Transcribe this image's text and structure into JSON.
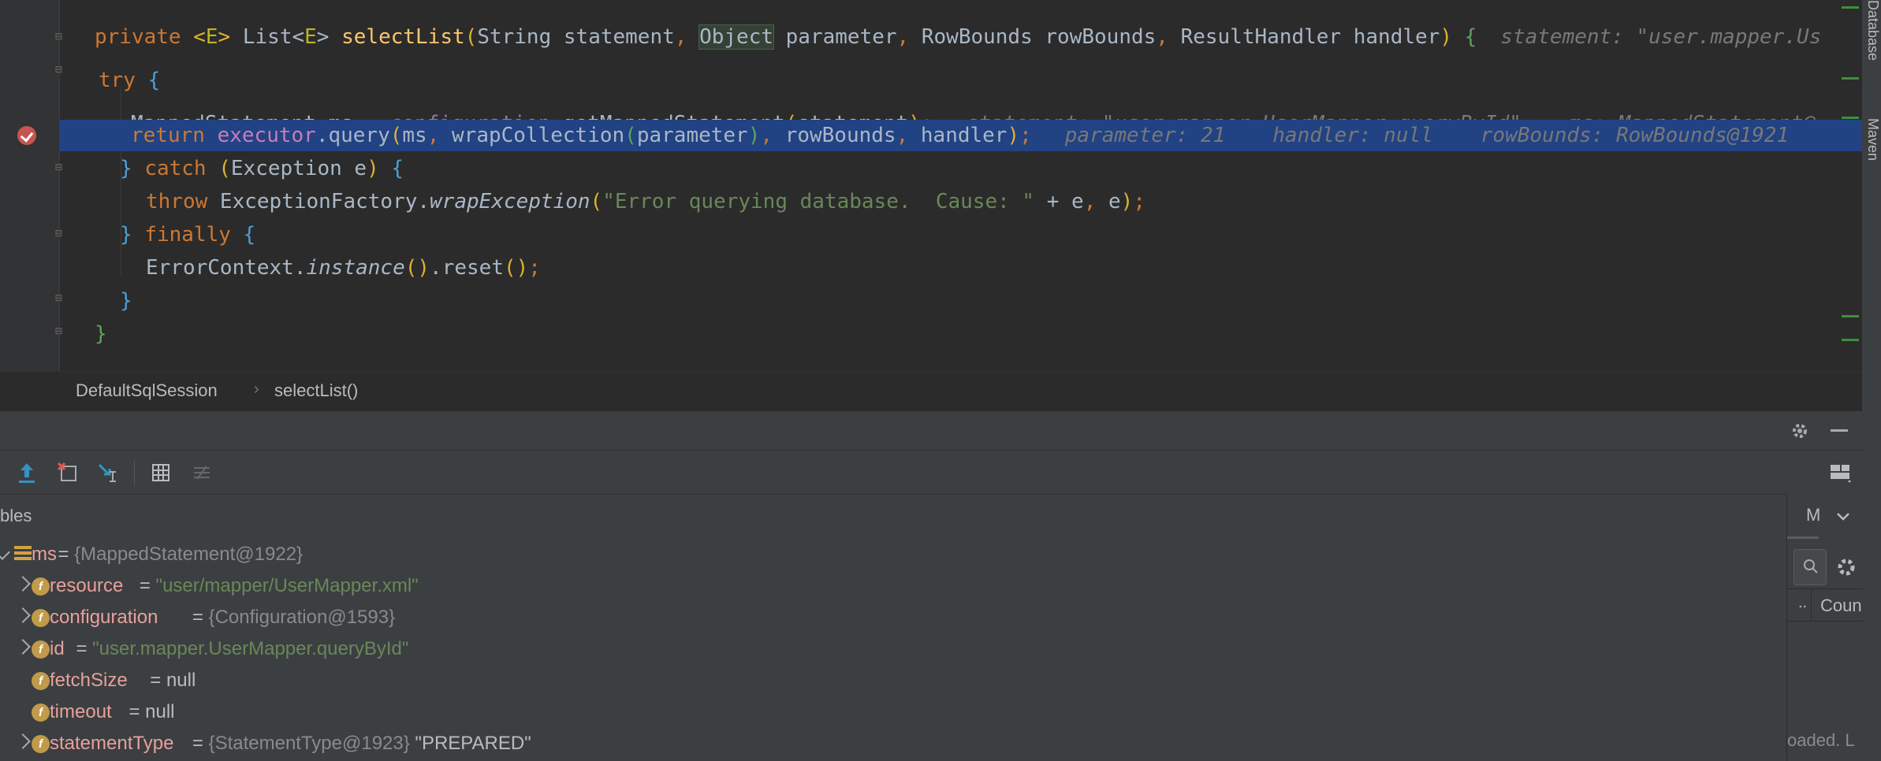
{
  "colors": {
    "editor_bg": "#2b2b2b",
    "panel_bg": "#3c3f41",
    "highlight_line": "#214283",
    "keyword": "#cc7832",
    "function": "#ffc66d",
    "field": "#9876aa",
    "string": "#6a8759",
    "var_name": "#e8a09c",
    "breakpoint": "#c75450"
  },
  "editor": {
    "lines": {
      "l1": {
        "private": "private ",
        "gen_open": "<",
        "gen_e": "E",
        "gen_close": "> ",
        "list": "List",
        "lt": "<",
        "e2": "E",
        "gt": "> ",
        "method": "selectList",
        "paren": "(",
        "p1": "String statement",
        "comma1": ", ",
        "object": "Object",
        "p2": " parameter",
        "comma2": ", ",
        "p3": "RowBounds rowBounds",
        "comma3": ", ",
        "p4": "ResultHandler handler",
        "close": ") ",
        "brace": "{",
        "hint": "statement: \"user.mapper.Us"
      },
      "l2": {
        "kw": "try ",
        "brace": "{"
      },
      "l3": {
        "type": "MappedStatement ms = ",
        "field": "configuration",
        "call": ".getMappedStatement",
        "paren_open": "(",
        "arg": "statement",
        "paren_close": ")",
        "semi": ";",
        "hint1": "statement: \"user.mapper.UserMapper.queryById\"",
        "hint2": "ms: MappedStatement@"
      },
      "l4": {
        "kw": "return ",
        "field": "executor",
        "call": ".query",
        "paren_open": "(",
        "a1": "ms",
        "c1": ", ",
        "a2": "wrapCollection",
        "p_open": "(",
        "a2arg": "parameter",
        "p_close": ")",
        "c2": ", ",
        "a3": "rowBounds",
        "c3": ", ",
        "a4": "handler",
        "paren_close": ")",
        "semi": ";",
        "hint1": "parameter: 21",
        "hint2": "handler: null",
        "hint3": "rowBounds: RowBounds@1921"
      },
      "l5": {
        "brace": "} ",
        "kw": "catch ",
        "paren_open": "(",
        "arg": "Exception e",
        "paren_close": ") ",
        "brace2": "{"
      },
      "l6": {
        "kw": "throw ",
        "cls": "ExceptionFactory.",
        "method": "wrapException",
        "paren_open": "(",
        "str": "\"Error querying database.  Cause: \"",
        "rest": " + e",
        "comma": ", ",
        "e": "e",
        "paren_close": ")",
        "semi": ";"
      },
      "l7": {
        "brace": "} ",
        "kw": "finally ",
        "brace2": "{"
      },
      "l8": {
        "cls": "ErrorContext.",
        "method": "instance",
        "p1": "()",
        "call": ".reset",
        "p2": "()",
        "semi": ";"
      },
      "l9": {
        "brace": "}"
      },
      "l10": {
        "brace": "}"
      }
    }
  },
  "right_strip": {
    "database_tab": "Database",
    "maven_tab": "Maven"
  },
  "breadcrumb": {
    "item1": "DefaultSqlSession",
    "item2": "selectList()"
  },
  "debug": {
    "vars_title": "bles",
    "watches_tab": "M",
    "watches_col": "Coun",
    "watches_dots": "..",
    "loaded_text": "oaded. L",
    "variables": [
      {
        "name": "ms",
        "eq": " = ",
        "value": "{MappedStatement@1922}",
        "expanded": true,
        "kind": "object"
      },
      {
        "name": "resource",
        "eq": " = ",
        "value": "\"user/mapper/UserMapper.xml\"",
        "kind": "field",
        "is_string": true,
        "has_arrow": true
      },
      {
        "name": "configuration",
        "eq": " = ",
        "value": "{Configuration@1593}",
        "kind": "field",
        "has_arrow": true
      },
      {
        "name": "id",
        "eq": " = ",
        "value": "\"user.mapper.UserMapper.queryById\"",
        "kind": "field",
        "is_string": true,
        "has_arrow": true
      },
      {
        "name": "fetchSize",
        "eq": " = ",
        "value": "null",
        "kind": "field",
        "has_arrow": false
      },
      {
        "name": "timeout",
        "eq": " = ",
        "value": "null",
        "kind": "field",
        "has_arrow": false
      },
      {
        "name": "statementType",
        "eq": " = ",
        "value": "{StatementType@1923}",
        "extra": " \"PREPARED\"",
        "kind": "field",
        "has_arrow": true
      }
    ]
  }
}
